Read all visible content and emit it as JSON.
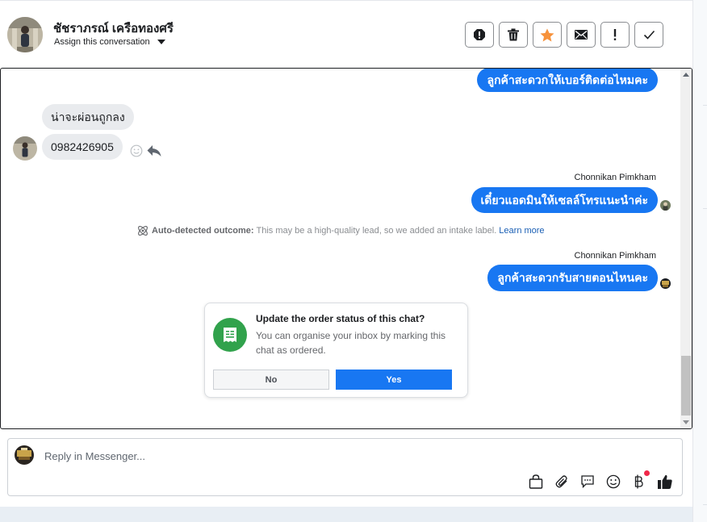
{
  "header": {
    "contact_name": "ชัชราภรณ์ เครือทองศรี",
    "assign_label": "Assign this conversation",
    "actions": [
      {
        "name": "spam-icon"
      },
      {
        "name": "trash-icon"
      },
      {
        "name": "star-icon"
      },
      {
        "name": "mail-icon"
      },
      {
        "name": "exclamation-icon"
      },
      {
        "name": "check-icon"
      }
    ],
    "star_color": "#f7923b"
  },
  "messages": {
    "out_1": "ลูกค้าสะดวกให้เบอร์ติดต่อไหมคะ",
    "in_1": "น่าจะผ่อนถูกลง",
    "in_2": "0982426905",
    "sender_1": "Chonnikan Pimkham",
    "out_2": "เดี๋ยวแอดมินให้เซลล์โทรแนะนำค่ะ",
    "notice_bold": "Auto-detected outcome:",
    "notice_text": "This may be a high-quality lead, so we added an intake label.",
    "notice_link": "Learn more",
    "sender_2": "Chonnikan Pimkham",
    "out_3": "ลูกค้าสะดวกรับสายตอนไหนคะ"
  },
  "order_card": {
    "title": "Update the order status of this chat?",
    "body": "You can organise your inbox by marking this chat as ordered.",
    "no_label": "No",
    "yes_label": "Yes"
  },
  "composer": {
    "placeholder": "Reply in Messenger...",
    "tools": [
      "bag-icon",
      "paperclip-icon",
      "saved-reply-icon",
      "emoji-icon",
      "baht-icon",
      "thumbs-up-icon"
    ]
  },
  "colors": {
    "accent": "#1877f2",
    "green": "#31a24c",
    "notification": "#f02849"
  }
}
